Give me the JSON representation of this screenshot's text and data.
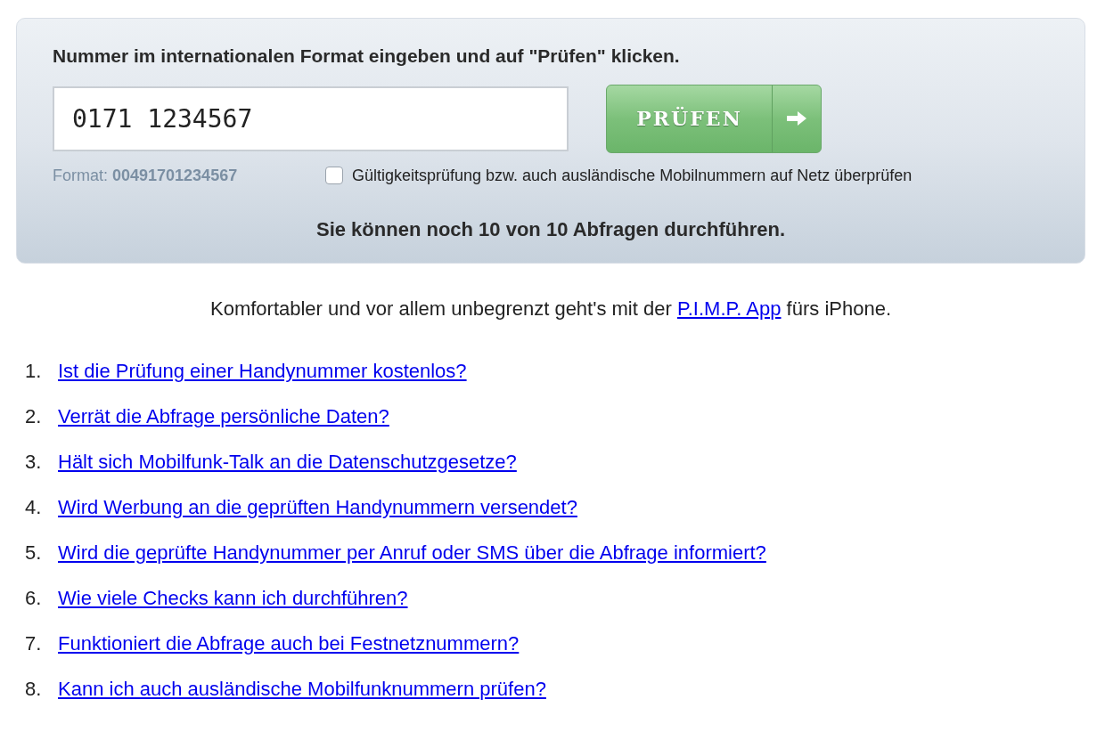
{
  "panel": {
    "instruction": "Nummer im internationalen Format eingeben und auf \"Prüfen\" klicken.",
    "number_field": {
      "value": "0171 1234567"
    },
    "submit_button": {
      "label": "PRÜFEN"
    },
    "format_hint": "Format: **00491701234567**",
    "check_abroad": {
      "label": "Gültigkeitsprüfung bzw. auch ausländische Mobilnummern auf Netz überprüfen",
      "checked": false
    },
    "quota": "Sie können noch 10 von 10 Abfragen durchführen."
  },
  "promo": {
    "before": "Komfortabler und vor allem unbegrenzt geht's mit der ",
    "link": "P.I.M.P. App",
    "after": " fürs iPhone."
  },
  "faq": [
    {
      "number": "1.",
      "question": "Ist die Prüfung einer Handynummer kostenlos?"
    },
    {
      "number": "2.",
      "question": "Verrät die Abfrage persönliche Daten?"
    },
    {
      "number": "3.",
      "question": "Hält sich Mobilfunk-Talk an die Datenschutzgesetze?"
    },
    {
      "number": "4.",
      "question": "Wird Werbung an die geprüften Handynummern versendet?"
    },
    {
      "number": "5.",
      "question": "Wird die geprüfte Handynummer per Anruf oder SMS über die Abfrage informiert?"
    },
    {
      "number": "6.",
      "question": "Wie viele Checks kann ich durchführen?"
    },
    {
      "number": "7.",
      "question": "Funktioniert die Abfrage auch bei Festnetznummern?"
    },
    {
      "number": "8.",
      "question": "Kann ich auch ausländische Mobilfunknummern prüfen?"
    }
  ]
}
